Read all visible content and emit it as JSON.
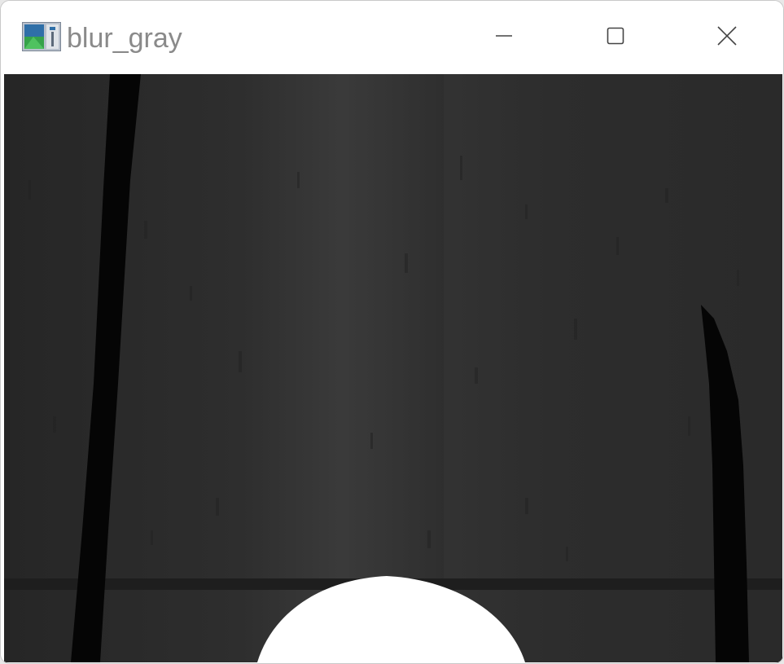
{
  "window": {
    "title": "blur_gray",
    "icon": "opencv-window-icon",
    "controls": {
      "minimize": "minimize-icon",
      "maximize": "maximize-icon",
      "close": "close-icon"
    }
  },
  "image": {
    "name": "blur_gray",
    "mode": "grayscale",
    "colors": {
      "background": "#2e2e2e",
      "light_band": "#3a3a3a",
      "dark_lines": "#050505",
      "blob": "#ffffff"
    }
  }
}
